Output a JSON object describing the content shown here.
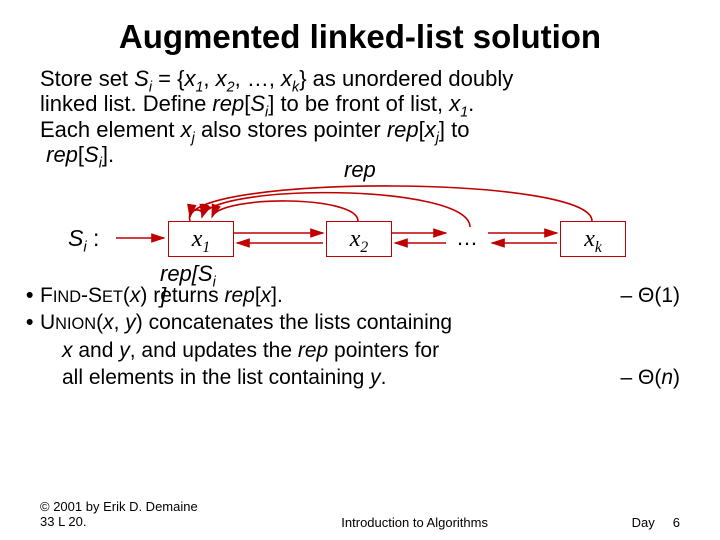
{
  "title": "Augmented linked-list solution",
  "para": {
    "l1a": "Store set ",
    "l1b": " = {",
    "l1c": ", ",
    "l1d": ", …, ",
    "l1e": "} as unordered doubly",
    "l2a": "linked list. Define ",
    "l2b": "[",
    "l2c": "] to be front of list, ",
    "l2d": ".",
    "l3a": "Each element ",
    "l3b": " also stores pointer ",
    "l3c": "[",
    "l3d": "] to",
    "l4a": "[",
    "l4b": "]."
  },
  "sym": {
    "Si": "S",
    "Si_sub": "i",
    "x1": "x",
    "x1_sub": "1",
    "x2": "x",
    "x2_sub": "2",
    "xk": "x",
    "xk_sub": "k",
    "xj": "x",
    "xj_sub": "j",
    "rep": "rep",
    "repsi": "rep",
    "repsi2a": "[S",
    "repsi2b": "]"
  },
  "diagram": {
    "si_colon": " :",
    "dots": "…",
    "rep_top": "rep",
    "repsi_under1": "rep[S",
    "repsi_under2": "]"
  },
  "bullets": {
    "b1a": "F",
    "b1b": "IND",
    "b1c": "-S",
    "b1d": "ET",
    "b1e": "(",
    "b1f": ") returns ",
    "b1g": "[",
    "b1h": "].",
    "b1r": "– Θ(1)",
    "b2a": "U",
    "b2b": "NION",
    "b2c": "(",
    "b2d": ", ",
    "b2e": ") concatenates the lists containing",
    "b2f": " and ",
    "b2g": ", and updates the ",
    "b2h": " pointers for",
    "b2i": "all elements in the list containing ",
    "b2j": ".",
    "b2r": "– Θ(",
    "b2r2": ")",
    "x": "x",
    "y": "y",
    "rep": "rep",
    "n": "n"
  },
  "footer": {
    "left1": "© 2001 by Erik D. Demaine",
    "left2": "33    L 20.",
    "mid": "Introduction to Algorithms",
    "right": "Day     6"
  }
}
